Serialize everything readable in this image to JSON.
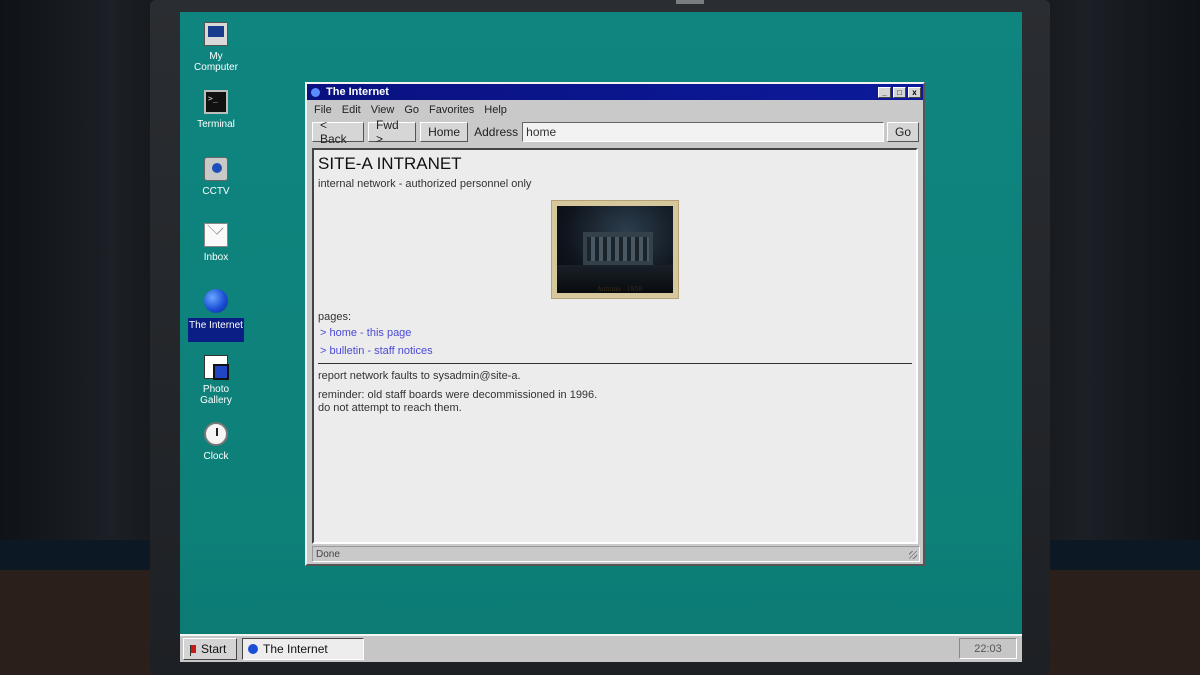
{
  "desktop": {
    "icons": [
      {
        "label": "My Computer",
        "icon": "computer-icon"
      },
      {
        "label": "Terminal",
        "icon": "terminal-icon"
      },
      {
        "label": "CCTV",
        "icon": "camera-icon"
      },
      {
        "label": "Inbox",
        "icon": "mail-icon"
      },
      {
        "label": "The Internet",
        "icon": "globe-icon",
        "selected": true
      },
      {
        "label": "Photo Gallery",
        "icon": "photo-gallery-icon"
      },
      {
        "label": "Clock",
        "icon": "clock-icon"
      }
    ]
  },
  "window": {
    "title": "The Internet",
    "controls": {
      "minimize": "_",
      "maximize": "□",
      "close": "x"
    },
    "menu": [
      "File",
      "Edit",
      "View",
      "Go",
      "Favorites",
      "Help"
    ],
    "toolbar": {
      "back_label": "< Back",
      "forward_label": "Fwd >",
      "home_label": "Home",
      "address_label": "Address",
      "address_value": "home",
      "go_label": "Go"
    },
    "page": {
      "title": "SITE-A INTRANET",
      "subtitle": "internal network - authorized personnel only",
      "image_caption": "Autumn - 1958",
      "pages_label": "pages:",
      "links": [
        "> home - this page",
        "> bulletin - staff notices"
      ],
      "faults_note": "report network faults to sysadmin@site-a.",
      "reminder_line1": "reminder: old staff boards were decommissioned in 1996.",
      "reminder_line2": "do not attempt to reach them."
    },
    "status": "Done"
  },
  "taskbar": {
    "start_label": "Start",
    "task_label": "The Internet",
    "clock": "22:03"
  },
  "colors": {
    "desktop": "#0f8580",
    "titlebar": "#0a1280",
    "link": "#4a4ad6",
    "selection": "#0a1e86"
  }
}
